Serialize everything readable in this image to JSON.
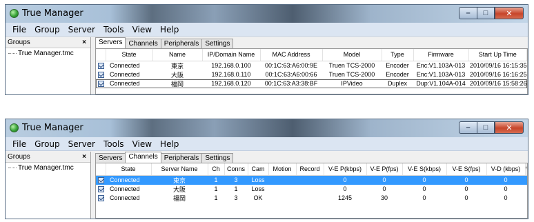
{
  "window1": {
    "title": "True Manager",
    "menu": [
      "File",
      "Group",
      "Server",
      "Tools",
      "View",
      "Help"
    ],
    "groups": {
      "header": "Groups",
      "close": "×",
      "items": [
        "True Manager.tmc"
      ]
    },
    "tabs": [
      "Servers",
      "Channels",
      "Peripherals",
      "Settings"
    ],
    "active_tab": "Servers",
    "columns": [
      "",
      "State",
      "Name",
      "IP/Domain Name",
      "MAC Address",
      "Model",
      "Type",
      "Firmware",
      "Start Up Time"
    ],
    "rows": [
      {
        "state": "Connected",
        "name": "東京",
        "ip": "192.168.0.100",
        "mac": "00:1C:63:A6:00:9E",
        "model": "Truen TCS-2000",
        "type": "Encoder",
        "firmware": "Enc:V1.103A-013",
        "startup": "2010/09/16 16:15:35"
      },
      {
        "state": "Connected",
        "name": "大阪",
        "ip": "192.168.0.110",
        "mac": "00:1C:63:A6:00:66",
        "model": "Truen TCS-2000",
        "type": "Encoder",
        "firmware": "Enc:V1.103A-013",
        "startup": "2010/09/16 16:16:25"
      },
      {
        "state": "Connected",
        "name": "福岡",
        "ip": "192.168.0.120",
        "mac": "00:1C:63:A3:38:BF",
        "model": "IPVideo",
        "type": "Duplex",
        "firmware": "Dup:V1.104A-014",
        "startup": "2010/09/16 15:58:26"
      }
    ]
  },
  "window2": {
    "title": "True Manager",
    "menu": [
      "File",
      "Group",
      "Server",
      "Tools",
      "View",
      "Help"
    ],
    "groups": {
      "header": "Groups",
      "close": "×",
      "items": [
        "True Manager.tmc"
      ]
    },
    "tabs": [
      "Servers",
      "Channels",
      "Peripherals",
      "Settings"
    ],
    "active_tab": "Channels",
    "columns": [
      "",
      "State",
      "Server Name",
      "Ch",
      "Conns",
      "Cam",
      "Motion",
      "Record",
      "V-E P(kbps)",
      "V-E P(fps)",
      "V-E S(kbps)",
      "V-E S(fps)",
      "V-D (kbps)",
      "V-"
    ],
    "rows": [
      {
        "state": "Connected",
        "server": "東京",
        "ch": "1",
        "conns": "3",
        "cam": "Loss",
        "motion": "",
        "record": "",
        "vep_kbps": "0",
        "vep_fps": "0",
        "ves_kbps": "0",
        "ves_fps": "0",
        "vd_kbps": "0"
      },
      {
        "state": "Connected",
        "server": "大阪",
        "ch": "1",
        "conns": "1",
        "cam": "Loss",
        "motion": "",
        "record": "",
        "vep_kbps": "0",
        "vep_fps": "0",
        "ves_kbps": "0",
        "ves_fps": "0",
        "vd_kbps": "0"
      },
      {
        "state": "Connected",
        "server": "福岡",
        "ch": "1",
        "conns": "3",
        "cam": "OK",
        "motion": "",
        "record": "",
        "vep_kbps": "1245",
        "vep_fps": "30",
        "ves_kbps": "0",
        "ves_fps": "0",
        "vd_kbps": "0"
      }
    ],
    "selected_row": 0
  },
  "colors": {
    "selection": "#3399ff",
    "menubar": "#dbe5f2",
    "close_button": "#c7452a"
  }
}
